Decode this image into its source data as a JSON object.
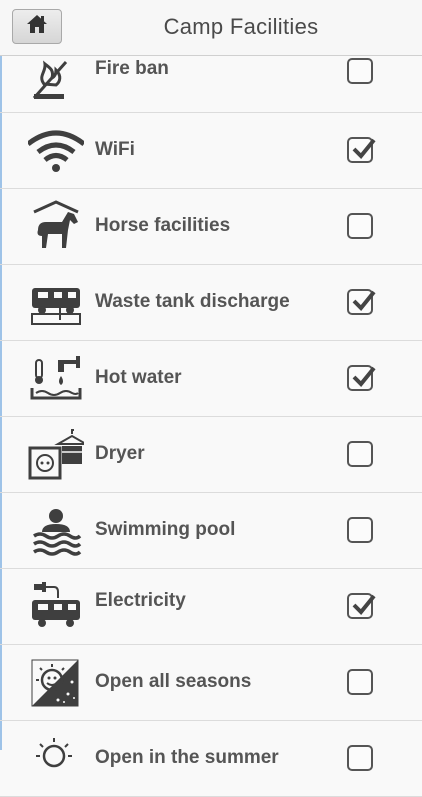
{
  "header": {
    "title": "Camp Facilities",
    "home_icon": "home-icon"
  },
  "facilities": [
    {
      "label": "Fire ban",
      "icon": "fire-ban-icon",
      "checked": false
    },
    {
      "label": "WiFi",
      "icon": "wifi-icon",
      "checked": true
    },
    {
      "label": "Horse facilities",
      "icon": "horse-icon",
      "checked": false
    },
    {
      "label": "Waste tank discharge",
      "icon": "waste-tank-icon",
      "checked": true
    },
    {
      "label": "Hot water",
      "icon": "hot-water-icon",
      "checked": true
    },
    {
      "label": "Dryer",
      "icon": "dryer-icon",
      "checked": false
    },
    {
      "label": "Swimming pool",
      "icon": "swimming-pool-icon",
      "checked": false
    },
    {
      "label": "Electricity",
      "icon": "electricity-icon",
      "checked": true
    },
    {
      "label": "Open all seasons",
      "icon": "all-seasons-icon",
      "checked": false
    },
    {
      "label": "Open in the summer",
      "icon": "summer-icon",
      "checked": false
    }
  ],
  "colors": {
    "icon": "#3f3f3f",
    "text": "#555555",
    "background": "#f9f9f9"
  }
}
